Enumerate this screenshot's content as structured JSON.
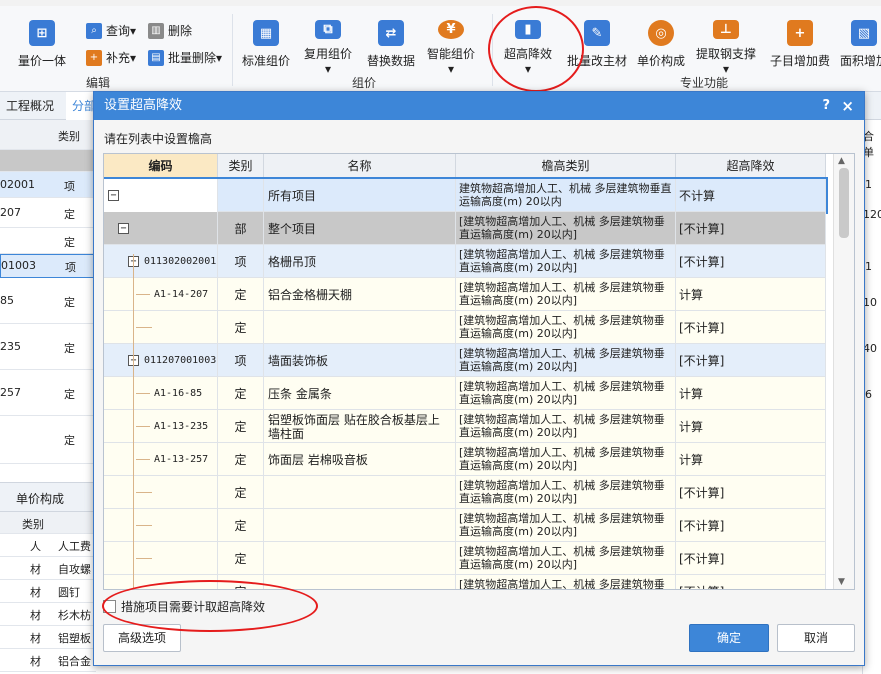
{
  "ribbon": {
    "small_buttons": [
      {
        "label": "查询",
        "icon": "search-icon",
        "color": "#3a7bd5"
      },
      {
        "label": "删除",
        "icon": "trash-icon",
        "color": "#8a8a8a"
      },
      {
        "label": "补充",
        "icon": "plus-icon",
        "color": "#e07a1f"
      },
      {
        "label": "批量删除",
        "icon": "batch-delete-icon",
        "color": "#3a7bd5"
      }
    ],
    "left_button": {
      "label": "量价一体",
      "icon": "price-icon"
    },
    "buttons": [
      {
        "label": "标准组价",
        "icon": "grid-icon",
        "color": "#3a7bd5"
      },
      {
        "label": "复用组价",
        "icon": "copy-icon",
        "color": "#3a7bd5"
      },
      {
        "label": "替换数据",
        "icon": "replace-icon",
        "color": "#3a7bd5"
      },
      {
        "label": "智能组价",
        "icon": "smart-icon",
        "color": "#e07a1f"
      },
      {
        "label": "超高降效",
        "icon": "height-icon",
        "color": "#3a7bd5"
      },
      {
        "label": "批量改主材",
        "icon": "edit-icon",
        "color": "#3a7bd5"
      },
      {
        "label": "单价构成",
        "icon": "coin-icon",
        "color": "#e07a1f"
      },
      {
        "label": "提取钢支撑",
        "icon": "steel-icon",
        "color": "#e07a1f"
      },
      {
        "label": "子目增加费",
        "icon": "add-fee-icon",
        "color": "#e07a1f"
      },
      {
        "label": "面积增加",
        "icon": "area-icon",
        "color": "#3a7bd5"
      }
    ],
    "groups": [
      "编辑",
      "组价",
      "专业功能"
    ]
  },
  "background": {
    "tabs": [
      "工程概况",
      "分部"
    ],
    "header_col": "类别",
    "rows": [
      {
        "code": "02001",
        "kind": "项"
      },
      {
        "code": "207",
        "kind": "定"
      },
      {
        "code": "",
        "kind": "定"
      },
      {
        "code": "01003",
        "kind": "项"
      },
      {
        "code": "85",
        "kind": "定"
      },
      {
        "code": "235",
        "kind": "定"
      },
      {
        "code": "257",
        "kind": "定"
      },
      {
        "code": "",
        "kind": "定"
      }
    ],
    "bottom_tab": "单价构成",
    "bottom_header": "类别",
    "bottom_rows": [
      {
        "kind": "人",
        "name": "人工费"
      },
      {
        "kind": "材",
        "name": "自攻螺"
      },
      {
        "kind": "材",
        "name": "圆钉"
      },
      {
        "kind": "材",
        "name": "杉木枋"
      },
      {
        "kind": "材",
        "name": "铝塑板"
      },
      {
        "kind": "材",
        "name": "铝合金"
      }
    ],
    "right_values": [
      "合单",
      "1",
      "120",
      "1",
      "10",
      "40",
      "6"
    ]
  },
  "dialog": {
    "title": "设置超高降效",
    "help": "?",
    "close": "×",
    "hint": "请在列表中设置檐高",
    "columns": [
      "编码",
      "类别",
      "名称",
      "檐高类别",
      "超高降效"
    ],
    "rows": [
      {
        "level": 0,
        "toggle": "−",
        "code": "",
        "kind": "",
        "name": "所有项目",
        "height": "建筑物超高增加人工、机械 多层建筑物垂直运输高度(m) 20以内",
        "effect": "不计算",
        "style": "selected"
      },
      {
        "level": 1,
        "toggle": "−",
        "code": "",
        "kind": "部",
        "name": "整个项目",
        "height": "[建筑物超高增加人工、机械 多层建筑物垂直运输高度(m) 20以内]",
        "effect": "[不计算]",
        "style": "section"
      },
      {
        "level": 2,
        "toggle": "−",
        "code": "011302002001",
        "kind": "项",
        "name": "格栅吊顶",
        "height": "[建筑物超高增加人工、机械 多层建筑物垂直运输高度(m) 20以内]",
        "effect": "[不计算]",
        "style": "item"
      },
      {
        "level": 3,
        "toggle": "",
        "code": "A1-14-207",
        "kind": "定",
        "name": "铝合金格栅天棚",
        "height": "[建筑物超高增加人工、机械 多层建筑物垂直运输高度(m) 20以内]",
        "effect": "计算",
        "style": "norm"
      },
      {
        "level": 3,
        "toggle": "",
        "code": "",
        "kind": "定",
        "name": "",
        "height": "[建筑物超高增加人工、机械 多层建筑物垂直运输高度(m) 20以内]",
        "effect": "[不计算]",
        "style": "norm"
      },
      {
        "level": 2,
        "toggle": "−",
        "code": "011207001003",
        "kind": "项",
        "name": "墙面装饰板",
        "height": "[建筑物超高增加人工、机械 多层建筑物垂直运输高度(m) 20以内]",
        "effect": "[不计算]",
        "style": "item"
      },
      {
        "level": 3,
        "toggle": "",
        "code": "A1-16-85",
        "kind": "定",
        "name": "压条 金属条",
        "height": "[建筑物超高增加人工、机械 多层建筑物垂直运输高度(m) 20以内]",
        "effect": "计算",
        "style": "norm"
      },
      {
        "level": 3,
        "toggle": "",
        "code": "A1-13-235",
        "kind": "定",
        "name": "铝塑板饰面层 贴在胶合板基层上 墙柱面",
        "height": "[建筑物超高增加人工、机械 多层建筑物垂直运输高度(m) 20以内]",
        "effect": "计算",
        "style": "norm"
      },
      {
        "level": 3,
        "toggle": "",
        "code": "A1-13-257",
        "kind": "定",
        "name": "饰面层 岩棉吸音板",
        "height": "[建筑物超高增加人工、机械 多层建筑物垂直运输高度(m) 20以内]",
        "effect": "计算",
        "style": "norm"
      },
      {
        "level": 3,
        "toggle": "",
        "code": "",
        "kind": "定",
        "name": "",
        "height": "[建筑物超高增加人工、机械 多层建筑物垂直运输高度(m) 20以内]",
        "effect": "[不计算]",
        "style": "norm"
      },
      {
        "level": 3,
        "toggle": "",
        "code": "",
        "kind": "定",
        "name": "",
        "height": "[建筑物超高增加人工、机械 多层建筑物垂直运输高度(m) 20以内]",
        "effect": "[不计算]",
        "style": "norm"
      },
      {
        "level": 3,
        "toggle": "",
        "code": "",
        "kind": "定",
        "name": "",
        "height": "[建筑物超高增加人工、机械 多层建筑物垂直运输高度(m) 20以内]",
        "effect": "[不计算]",
        "style": "norm"
      },
      {
        "level": 3,
        "toggle": "",
        "code": "",
        "kind": "定",
        "name": "",
        "height": "[建筑物超高增加人工、机械 多层建筑物垂直运输高度(m) 20以内]",
        "effect": "[不计算]",
        "style": "norm"
      }
    ],
    "checkbox_label": "措施项目需要计取超高降效",
    "advanced_label": "高级选项",
    "ok_label": "确定",
    "cancel_label": "取消"
  },
  "colors": {
    "accent": "#3d86d8",
    "annotation": "#e51c1c",
    "selected_row": "#dceafb",
    "section_row": "#c8c8c8",
    "item_row": "#e4eefa",
    "norm_row": "#fffef2"
  }
}
